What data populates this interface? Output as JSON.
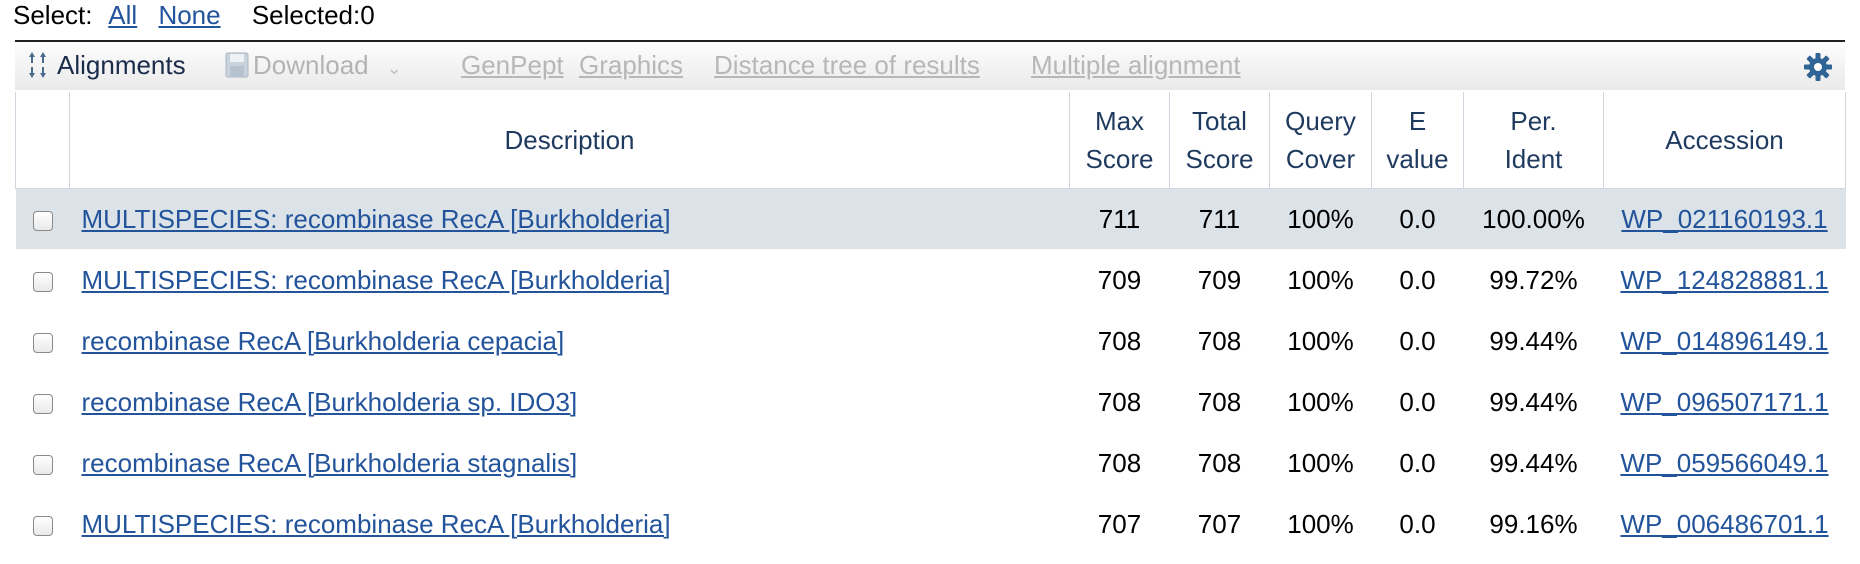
{
  "select_bar": {
    "label": "Select:",
    "all_link": "All",
    "none_link": "None",
    "selected_text": "Selected:0"
  },
  "toolbar": {
    "alignments_label": "Alignments",
    "alignments_icon": "sort-arrows-icon",
    "download_label": "Download",
    "download_icon": "save-disk-icon",
    "download_caret": "⌄",
    "genpept_label": "GenPept",
    "graphics_label": "Graphics",
    "distance_tree_label": "Distance tree of results",
    "multiple_alignment_label": "Multiple alignment",
    "settings_icon": "gear-icon"
  },
  "table": {
    "headers": {
      "description": "Description",
      "max_score_1": "Max",
      "max_score_2": "Score",
      "total_score_1": "Total",
      "total_score_2": "Score",
      "query_cover_1": "Query",
      "query_cover_2": "Cover",
      "e_value_1": "E",
      "e_value_2": "value",
      "per_ident_1": "Per.",
      "per_ident_2": "Ident",
      "accession": "Accession"
    },
    "rows": [
      {
        "description": "MULTISPECIES: recombinase RecA [Burkholderia]",
        "max_score": "711",
        "total_score": "711",
        "query_cover": "100%",
        "e_value": "0.0",
        "per_ident": "100.00%",
        "accession": "WP_021160193.1",
        "highlighted": true
      },
      {
        "description": "MULTISPECIES: recombinase RecA [Burkholderia]",
        "max_score": "709",
        "total_score": "709",
        "query_cover": "100%",
        "e_value": "0.0",
        "per_ident": "99.72%",
        "accession": "WP_124828881.1",
        "highlighted": false
      },
      {
        "description": "recombinase RecA [Burkholderia cepacia]",
        "max_score": "708",
        "total_score": "708",
        "query_cover": "100%",
        "e_value": "0.0",
        "per_ident": "99.44%",
        "accession": "WP_014896149.1",
        "highlighted": false
      },
      {
        "description": "recombinase RecA [Burkholderia sp. IDO3]",
        "max_score": "708",
        "total_score": "708",
        "query_cover": "100%",
        "e_value": "0.0",
        "per_ident": "99.44%",
        "accession": "WP_096507171.1",
        "highlighted": false
      },
      {
        "description": "recombinase RecA [Burkholderia stagnalis]",
        "max_score": "708",
        "total_score": "708",
        "query_cover": "100%",
        "e_value": "0.0",
        "per_ident": "99.44%",
        "accession": "WP_059566049.1",
        "highlighted": false
      },
      {
        "description": "MULTISPECIES: recombinase RecA [Burkholderia]",
        "max_score": "707",
        "total_score": "707",
        "query_cover": "100%",
        "e_value": "0.0",
        "per_ident": "99.16%",
        "accession": "WP_006486701.1",
        "highlighted": false
      }
    ]
  },
  "colors": {
    "link": "#23549b",
    "header_text": "#1f3a5f",
    "highlight_row": "#dbe2e8",
    "disabled_text": "#b7b7b7"
  }
}
